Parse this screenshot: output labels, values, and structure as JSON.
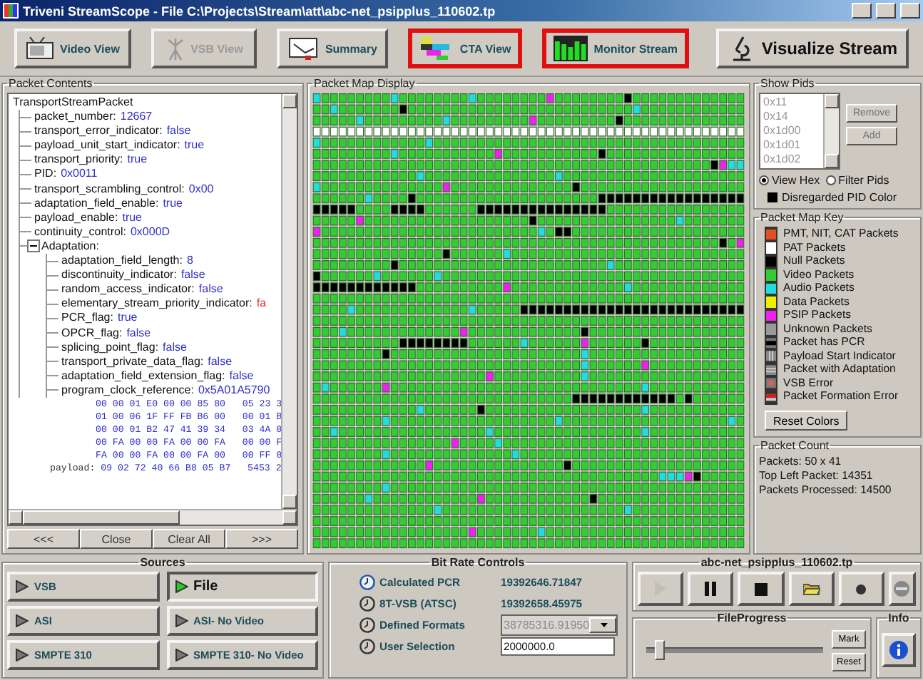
{
  "window": {
    "title": "Triveni StreamScope - File C:\\Projects\\Stream\\att\\abc-net_psipplus_110602.tp"
  },
  "toolbar": [
    {
      "kind": "video",
      "label": "Video View",
      "disabled": false,
      "highlighted": false
    },
    {
      "kind": "vsb",
      "label": "VSB View",
      "disabled": true,
      "highlighted": false
    },
    {
      "kind": "summary",
      "label": "Summary",
      "disabled": false,
      "highlighted": false
    },
    {
      "kind": "cta",
      "label": "CTA View",
      "disabled": false,
      "highlighted": true
    },
    {
      "kind": "monitor",
      "label": "Monitor Stream",
      "disabled": false,
      "highlighted": true
    },
    {
      "kind": "visualize",
      "label": "Visualize Stream",
      "disabled": false,
      "highlighted": false
    }
  ],
  "packet_contents": {
    "title": "Packet Contents",
    "tree": {
      "label": "TransportStreamPacket",
      "children": [
        {
          "label": "packet_number:",
          "value": "12667",
          "color": "#3030c8"
        },
        {
          "label": "transport_error_indicator:",
          "value": "false",
          "color": "#3030c8"
        },
        {
          "label": "payload_unit_start_indicator:",
          "value": "true",
          "color": "#3030c8"
        },
        {
          "label": "transport_priority:",
          "value": "true",
          "color": "#3030c8"
        },
        {
          "label": "PID:",
          "value": "0x0011",
          "color": "#3030c8"
        },
        {
          "label": "transport_scrambling_control:",
          "value": "0x00",
          "color": "#3030c8"
        },
        {
          "label": "adaptation_field_enable:",
          "value": "true",
          "color": "#3030c8"
        },
        {
          "label": "payload_enable:",
          "value": "true",
          "color": "#3030c8"
        },
        {
          "label": "continuity_control:",
          "value": "0x000D",
          "color": "#3030c8"
        },
        {
          "label": "Adaptation:",
          "expanded": true,
          "children": [
            {
              "label": "adaptation_field_length:",
              "value": "8",
              "color": "#3030c8"
            },
            {
              "label": "discontinuity_indicator:",
              "value": "false",
              "color": "#3030c8"
            },
            {
              "label": "random_access_indicator:",
              "value": "false",
              "color": "#3030c8"
            },
            {
              "label": "elementary_stream_priority_indicator:",
              "value": "fa",
              "color": "#e03030"
            },
            {
              "label": "PCR_flag:",
              "value": "true",
              "color": "#3030c8"
            },
            {
              "label": "OPCR_flag:",
              "value": "false",
              "color": "#3030c8"
            },
            {
              "label": "splicing_point_flag:",
              "value": "false",
              "color": "#3030c8"
            },
            {
              "label": "transport_private_data_flag:",
              "value": "false",
              "color": "#3030c8"
            },
            {
              "label": "adaptation_field_extension_flag:",
              "value": "false",
              "color": "#3030c8"
            },
            {
              "label": "program_clock_reference:",
              "value": "0x5A01A5790",
              "color": "#3030c8"
            }
          ]
        }
      ]
    },
    "hex_lines": [
      "00 00 01 E0 00 00 85 80   05 23 3",
      "01 00 06 1F FF FB B6 00   00 01 B",
      "00 00 01 B2 47 41 39 34   03 4A 0",
      "00 FA 00 00 FA 00 00 FA   00 00 F",
      "FA 00 00 FA 00 00 FA 00   00 FF 0"
    ],
    "payload": {
      "label": "payload:",
      "value": "09 02 72 40 66 B8 05 B7   5453 2"
    },
    "buttons": [
      "<<<",
      "Close",
      "Clear All",
      ">>>"
    ]
  },
  "packet_map": {
    "title": "Packet Map Display"
  },
  "show_pids": {
    "title": "Show Pids",
    "pids": [
      "0x11",
      "0x14",
      "0x1d00",
      "0x1d01",
      "0x1d02"
    ],
    "buttons": [
      {
        "label": "Remove",
        "disabled": true
      },
      {
        "label": "Add",
        "disabled": true
      }
    ],
    "radios": [
      {
        "label": "View Hex",
        "selected": true
      },
      {
        "label": "Filter Pids",
        "selected": false
      }
    ],
    "disregarded": {
      "label": "Disregarded PID Color",
      "color": "#000000"
    }
  },
  "packet_map_key": {
    "title": "Packet Map Key",
    "items": [
      {
        "kind": "solid",
        "label": "PMT, NIT, CAT Packets",
        "color": "#e05020"
      },
      {
        "kind": "solid",
        "label": "PAT Packets",
        "color": "#ffffff"
      },
      {
        "kind": "solid",
        "label": "Null Packets",
        "color": "#000000"
      },
      {
        "kind": "solid",
        "label": "Video Packets",
        "color": "#33cc33"
      },
      {
        "kind": "solid",
        "label": "Audio Packets",
        "color": "#22dddd"
      },
      {
        "kind": "solid",
        "label": "Data Packets",
        "color": "#eeee00"
      },
      {
        "kind": "solid",
        "label": "PSIP Packets",
        "color": "#ee22ee"
      },
      {
        "kind": "solid",
        "label": "Unknown Packets",
        "color": "#999999"
      },
      {
        "kind": "bar",
        "label": "Packet has PCR",
        "color": "#000000"
      },
      {
        "kind": "vlines",
        "label": "Payload Start Indicator",
        "color": "#888888"
      },
      {
        "kind": "hlines",
        "label": "Packet with Adaptation",
        "color": "#888888"
      },
      {
        "kind": "dot",
        "label": "VSB Error",
        "color": "#cc6666"
      },
      {
        "kind": "redbar",
        "label": "Packet Formation Error",
        "color": "#cc2222"
      }
    ],
    "button": "Reset Colors"
  },
  "packet_count": {
    "title": "Packet Count",
    "lines": [
      "Packets: 50 x 41",
      "Top Left Packet: 14351",
      "Packets Processed: 14500"
    ]
  },
  "sources": {
    "title": "Sources",
    "buttons": [
      {
        "label": "VSB",
        "selected": false
      },
      {
        "label": "File",
        "selected": true
      },
      {
        "label": "ASI",
        "selected": false
      },
      {
        "label": "ASI- No Video",
        "selected": false
      },
      {
        "label": "SMPTE 310",
        "selected": false
      },
      {
        "label": "SMPTE 310- No Video",
        "selected": false
      }
    ]
  },
  "bit_rate": {
    "title": "Bit Rate Controls",
    "rows": [
      {
        "kind": "text",
        "label": "Calculated PCR",
        "value": "19392646.71847",
        "selected": true
      },
      {
        "kind": "text",
        "label": "8T-VSB (ATSC)",
        "value": "19392658.45975",
        "selected": false
      },
      {
        "kind": "dropdown",
        "label": "Defined Formats",
        "value": "38785316.91950",
        "selected": false,
        "disabled": true
      },
      {
        "kind": "input",
        "label": "User Selection",
        "value": "2000000.0",
        "selected": false
      }
    ]
  },
  "player": {
    "title": "abc-net_psipplus_110602.tp",
    "buttons": [
      {
        "kind": "play",
        "disabled": true
      },
      {
        "kind": "pause",
        "disabled": false
      },
      {
        "kind": "stop",
        "disabled": false
      },
      {
        "kind": "open",
        "disabled": false
      },
      {
        "kind": "record",
        "disabled": false
      },
      {
        "kind": "eject",
        "disabled": false
      }
    ],
    "progress": {
      "title": "FileProgress",
      "level": 0.05,
      "buttons": [
        "Mark",
        "Reset"
      ]
    },
    "info": {
      "title": "Info"
    }
  }
}
